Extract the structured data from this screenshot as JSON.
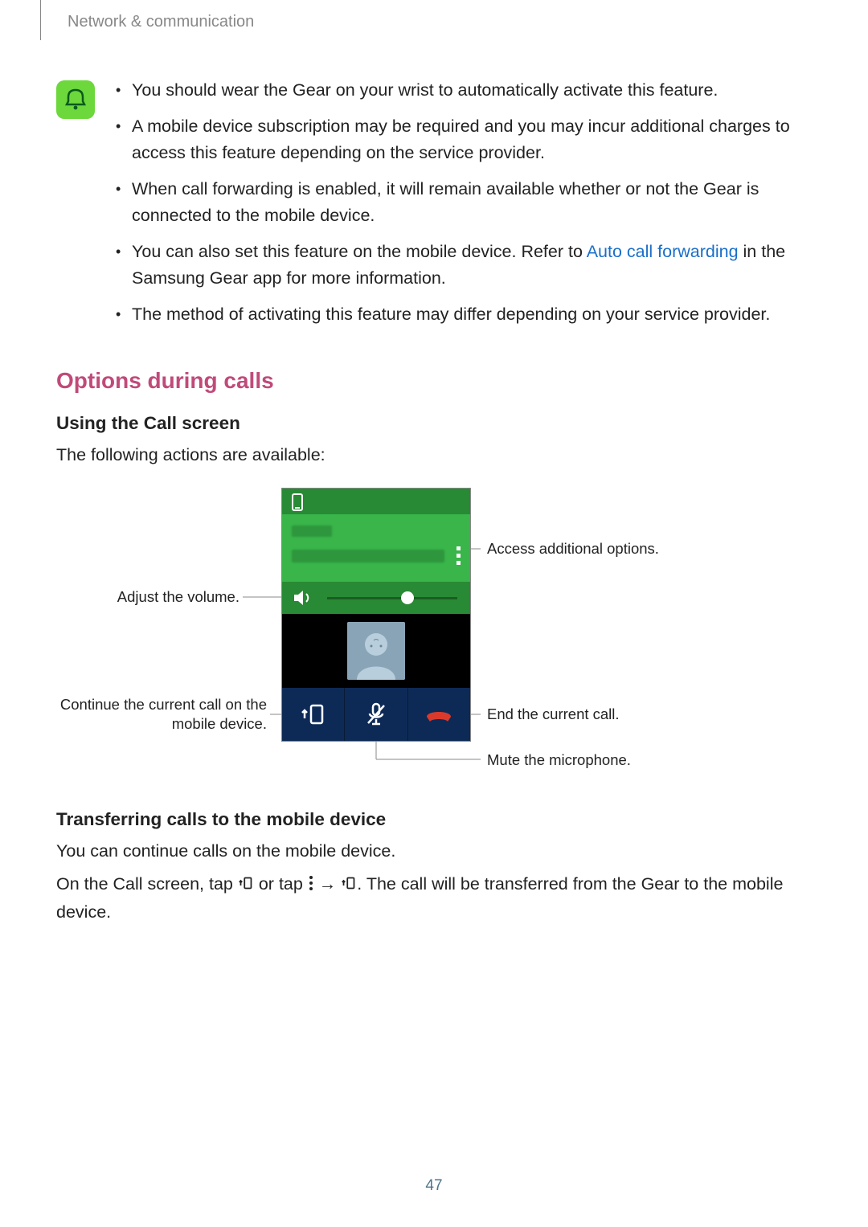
{
  "breadcrumb": "Network & communication",
  "notes": {
    "n1": "You should wear the Gear on your wrist to automatically activate this feature.",
    "n2": "A mobile device subscription may be required and you may incur additional charges to access this feature depending on the service provider.",
    "n3": "When call forwarding is enabled, it will remain available whether or not the Gear is connected to the mobile device.",
    "n4a": "You can also set this feature on the mobile device. Refer to ",
    "n4_link": "Auto call forwarding",
    "n4b": " in the Samsung Gear app for more information.",
    "n5": "The method of activating this feature may differ depending on your service provider."
  },
  "h2": "Options during calls",
  "sec1": {
    "title": "Using the Call screen",
    "intro": "The following actions are available:"
  },
  "callouts": {
    "more": "Access additional options.",
    "volume": "Adjust the volume.",
    "end": "End the current call.",
    "transfer1": "Continue the current call on the",
    "transfer2": "mobile device.",
    "mute": "Mute the microphone."
  },
  "sec2": {
    "title": "Transferring calls to the mobile device",
    "p1": "You can continue calls on the mobile device.",
    "p2a": "On the Call screen, tap ",
    "p2b": " or tap ",
    "p2c": " → ",
    "p2d": ". The call will be transferred from the Gear to the mobile device."
  },
  "page_number": "47"
}
